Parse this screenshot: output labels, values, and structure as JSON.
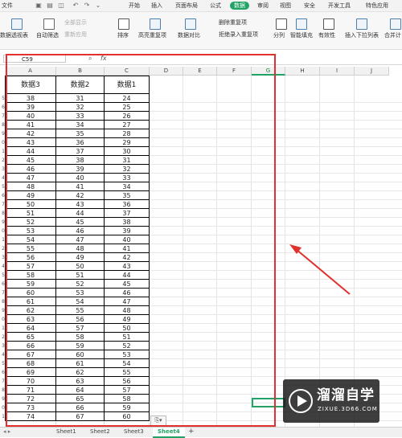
{
  "menubar": {
    "file": "文件",
    "tabs": [
      "开始",
      "插入",
      "页面布局",
      "公式",
      "数据",
      "审阅",
      "视图",
      "安全",
      "开发工具",
      "特色应用"
    ],
    "active_tab": "数据"
  },
  "ribbon": {
    "pivot": "数据透视表",
    "autofilter": "自动筛选",
    "show_all": "全部显示",
    "reapply": "重新应用",
    "sort": "排序",
    "highlight_dup": "高亮重复项",
    "data_compare": "数据对比",
    "remove_dup": "删除重复项",
    "reject_dup": "拒绝录入重复项",
    "split": "分列",
    "smart_fill": "智能填充",
    "validation": "有效性",
    "insert_dropdown": "插入下拉列表",
    "merge_calc": "合并计"
  },
  "formula_bar": {
    "name_box": "C59",
    "fx": "fx",
    "zoom_icon": "magnifier-icon"
  },
  "columns": [
    "A",
    "B",
    "C",
    "D",
    "E",
    "F",
    "G",
    "H",
    "I",
    "J"
  ],
  "selected_column": "G",
  "row_numbers_partial": [
    "5",
    "6",
    "7",
    "8",
    "9",
    "0",
    "1",
    "2",
    "3",
    "4",
    "5",
    "6",
    "7",
    "8",
    "9",
    "0",
    "1",
    "2",
    "3",
    "4",
    "5",
    "6",
    "7",
    "8",
    "9",
    "0",
    "1",
    "2",
    "3",
    "4",
    "5",
    "6",
    "7",
    "8",
    "9",
    "0",
    "1",
    "2",
    "3",
    "4",
    "5",
    "6",
    "7",
    "8",
    "9",
    "0",
    "1",
    "2",
    "3",
    "4",
    "5",
    "6",
    "7",
    "8",
    "9",
    "0",
    "1"
  ],
  "table": {
    "headers": [
      "数据3",
      "数据2",
      "数据1"
    ],
    "rows": [
      [
        "38",
        "31",
        "24"
      ],
      [
        "39",
        "32",
        "25"
      ],
      [
        "40",
        "33",
        "26"
      ],
      [
        "41",
        "34",
        "27"
      ],
      [
        "42",
        "35",
        "28"
      ],
      [
        "43",
        "36",
        "29"
      ],
      [
        "44",
        "37",
        "30"
      ],
      [
        "45",
        "38",
        "31"
      ],
      [
        "46",
        "39",
        "32"
      ],
      [
        "47",
        "40",
        "33"
      ],
      [
        "48",
        "41",
        "34"
      ],
      [
        "49",
        "42",
        "35"
      ],
      [
        "50",
        "43",
        "36"
      ],
      [
        "51",
        "44",
        "37"
      ],
      [
        "52",
        "45",
        "38"
      ],
      [
        "53",
        "46",
        "39"
      ],
      [
        "54",
        "47",
        "40"
      ],
      [
        "55",
        "48",
        "41"
      ],
      [
        "56",
        "49",
        "42"
      ],
      [
        "57",
        "50",
        "43"
      ],
      [
        "58",
        "51",
        "44"
      ],
      [
        "59",
        "52",
        "45"
      ],
      [
        "60",
        "53",
        "46"
      ],
      [
        "61",
        "54",
        "47"
      ],
      [
        "62",
        "55",
        "48"
      ],
      [
        "63",
        "56",
        "49"
      ],
      [
        "64",
        "57",
        "50"
      ],
      [
        "65",
        "58",
        "51"
      ],
      [
        "66",
        "59",
        "52"
      ],
      [
        "67",
        "60",
        "53"
      ],
      [
        "68",
        "61",
        "54"
      ],
      [
        "69",
        "62",
        "55"
      ],
      [
        "70",
        "63",
        "56"
      ],
      [
        "71",
        "64",
        "57"
      ],
      [
        "72",
        "65",
        "58"
      ],
      [
        "73",
        "66",
        "59"
      ],
      [
        "74",
        "67",
        "60"
      ]
    ]
  },
  "sheets": [
    "Sheet1",
    "Sheet2",
    "Sheet3",
    "Sheet4"
  ],
  "active_sheet": "Sheet4",
  "add_sheet": "+",
  "watermark": {
    "title": "溜溜自学",
    "subtitle": "ZIXUE.3D66.COM"
  },
  "colors": {
    "accent": "#21a366",
    "highlight": "#e0312f"
  }
}
